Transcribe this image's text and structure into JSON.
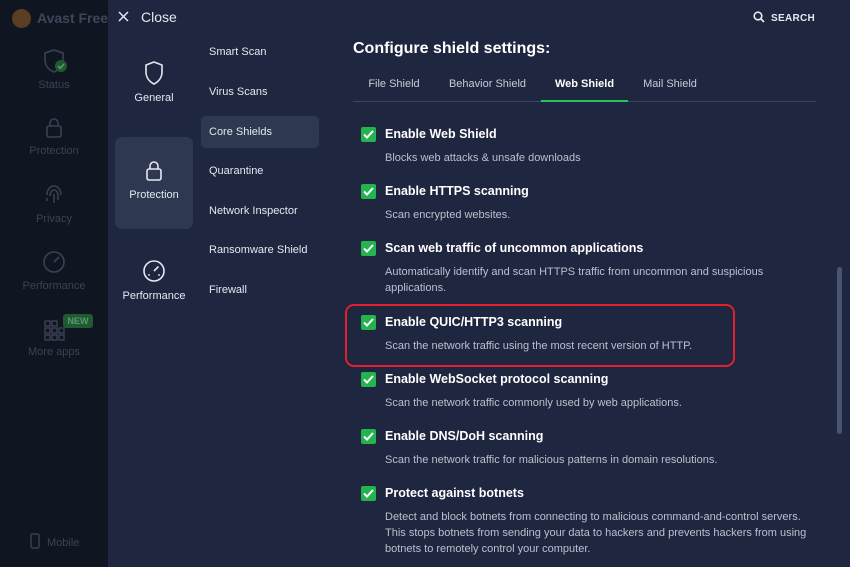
{
  "background_app": {
    "brand": "Avast Free A",
    "nav": {
      "status": "Status",
      "protection": "Protection",
      "privacy": "Privacy",
      "performance": "Performance",
      "more_apps": "More apps",
      "new_badge": "NEW",
      "mobile": "Mobile"
    }
  },
  "header": {
    "close_label": "Close",
    "search_label": "SEARCH"
  },
  "categories": [
    {
      "label": "General",
      "icon": "shield-icon"
    },
    {
      "label": "Protection",
      "icon": "lock-icon",
      "active": true
    },
    {
      "label": "Performance",
      "icon": "speedometer-icon"
    }
  ],
  "subnav": [
    {
      "label": "Smart Scan"
    },
    {
      "label": "Virus Scans"
    },
    {
      "label": "Core Shields",
      "active": true
    },
    {
      "label": "Quarantine"
    },
    {
      "label": "Network Inspector"
    },
    {
      "label": "Ransomware Shield"
    },
    {
      "label": "Firewall"
    }
  ],
  "content": {
    "title": "Configure shield settings:",
    "tabs": [
      {
        "label": "File Shield"
      },
      {
        "label": "Behavior Shield"
      },
      {
        "label": "Web Shield",
        "active": true
      },
      {
        "label": "Mail Shield"
      }
    ],
    "options": [
      {
        "label": "Enable Web Shield",
        "desc": "Blocks web attacks & unsafe downloads",
        "checked": true
      },
      {
        "label": "Enable HTTPS scanning",
        "desc": "Scan encrypted websites.",
        "checked": true
      },
      {
        "label": "Scan web traffic of uncommon applications",
        "desc": "Automatically identify and scan HTTPS traffic from uncommon and suspicious applications.",
        "checked": true
      },
      {
        "label": "Enable QUIC/HTTP3 scanning",
        "desc": "Scan the network traffic using the most recent version of HTTP.",
        "checked": true,
        "highlighted": true
      },
      {
        "label": "Enable WebSocket protocol scanning",
        "desc": "Scan the network traffic commonly used by web applications.",
        "checked": true
      },
      {
        "label": "Enable DNS/DoH scanning",
        "desc": "Scan the network traffic for malicious patterns in domain resolutions.",
        "checked": true
      },
      {
        "label": "Protect against botnets",
        "desc": "Detect and block botnets from connecting to malicious command-and-control servers. This stops botnets from sending your data to hackers and prevents hackers from using botnets to remotely control your computer.",
        "checked": true
      }
    ]
  },
  "colors": {
    "accent_green": "#23b44f",
    "highlight_red": "#e0202c",
    "panel_bg": "#1f2740"
  }
}
